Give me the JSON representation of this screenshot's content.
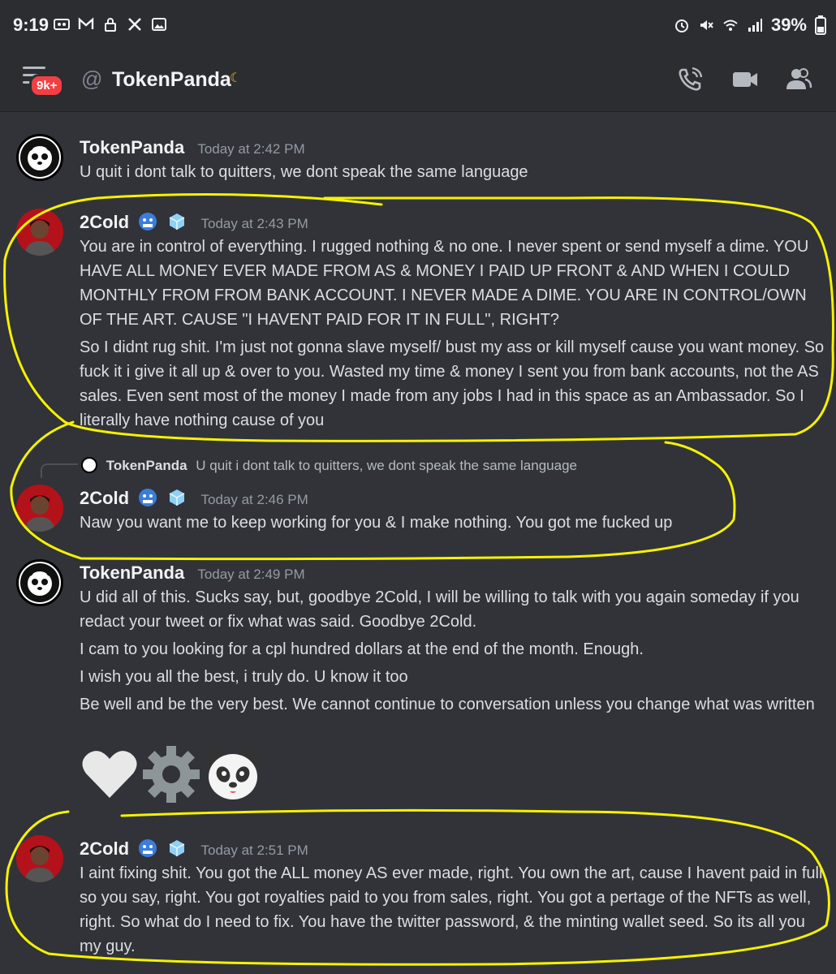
{
  "status_bar": {
    "time": "9:19",
    "battery": "39%"
  },
  "header": {
    "badge": "9k+",
    "channel_prefix": "@",
    "title": "TokenPanda"
  },
  "messages": [
    {
      "author": "TokenPanda",
      "timestamp": "Today at 2:42 PM",
      "lines": [
        "U quit i dont talk to quitters, we dont speak the same language"
      ]
    },
    {
      "author": "2Cold",
      "timestamp": "Today at 2:43 PM",
      "paragraphs": [
        "You are in control of everything. I rugged nothing & no one. I never spent or send myself a dime. YOU HAVE ALL MONEY EVER MADE FROM AS & MONEY I PAID UP FRONT & AND WHEN I COULD MONTHLY FROM FROM BANK ACCOUNT. I NEVER MADE A DIME. YOU ARE IN CONTROL/OWN OF THE ART. CAUSE \"I HAVENT PAID FOR IT IN FULL\", RIGHT?",
        "So I didnt rug shit. I'm just not gonna slave myself/ bust my ass or kill myself cause you want money. So fuck it i give it all up & over to you. Wasted my time & money I sent you from bank accounts, not the AS sales. Even sent most of the money I made from any jobs I had in this space as an Ambassador. So I literally have nothing cause of you"
      ]
    },
    {
      "reply_to_author": "TokenPanda",
      "reply_to_text": "U quit i dont talk to quitters, we dont speak the same language",
      "author": "2Cold",
      "timestamp": "Today at 2:46 PM",
      "lines": [
        "Naw you want me to keep working for you & I make nothing. You got me fucked up"
      ]
    },
    {
      "author": "TokenPanda",
      "timestamp": "Today at 2:49 PM",
      "paragraphs": [
        "U did all of this. Sucks say, but, goodbye 2Cold, I will be willing to talk with you again someday if you redact your tweet or fix what was said. Goodbye 2Cold.",
        "I cam to you looking for a cpl hundred dollars at the end of the month. Enough.",
        "I wish you all the best, i truly do. U know it too",
        "Be well and be the very best. We cannot continue to conversation unless you change what was written"
      ],
      "emojis": [
        "white-heart-icon",
        "gear-icon",
        "panda-face-icon"
      ]
    },
    {
      "author": "2Cold",
      "timestamp": "Today at 2:51 PM",
      "lines": [
        "I aint fixing shit. You got the ALL money AS ever made, right. You own the art, cause I havent paid in full so you say, right. You got royalties paid to you from sales, right. You got a pertage of the NFTs as well, right. So what do I need to fix. You have the twitter password, & the minting wallet seed. So its all you my guy."
      ]
    }
  ],
  "colors": {
    "background": "#313338",
    "header": "#2b2d31",
    "highlight": "#f5f200",
    "badge": "#f23f43"
  }
}
